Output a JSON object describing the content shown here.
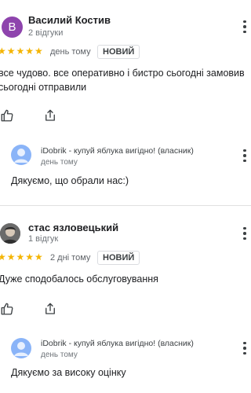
{
  "reviews": [
    {
      "avatar_letter": "В",
      "avatar_color": "#8e44ad",
      "author": "Василий Костив",
      "review_count": "2 відгуки",
      "stars": "★★★★★",
      "time": "день тому",
      "badge": "НОВИЙ",
      "text_line1": "все чудово. все оперативно і бистро сьогодні замовив",
      "text_line2": "сьогодні отправили",
      "owner": {
        "name": "iDobrik - купуй яблука вигідно! (власник)",
        "time": "день тому",
        "reply": "Дякуємо, що обрали нас:)"
      }
    },
    {
      "avatar_color": "#4a4a4a",
      "author": "стас язловецький",
      "review_count": "1 відгук",
      "stars": "★★★★★",
      "time": "2 дні тому",
      "badge": "НОВИЙ",
      "text_line1": "Дуже сподобалось обслуговування",
      "owner": {
        "name": "iDobrik - купуй яблука вигідно! (власник)",
        "time": "день тому",
        "reply": "Дякуємо за високу оцінку"
      }
    }
  ],
  "colors": {
    "star": "#f4b400",
    "owner_avatar": "#8ab4f8"
  }
}
